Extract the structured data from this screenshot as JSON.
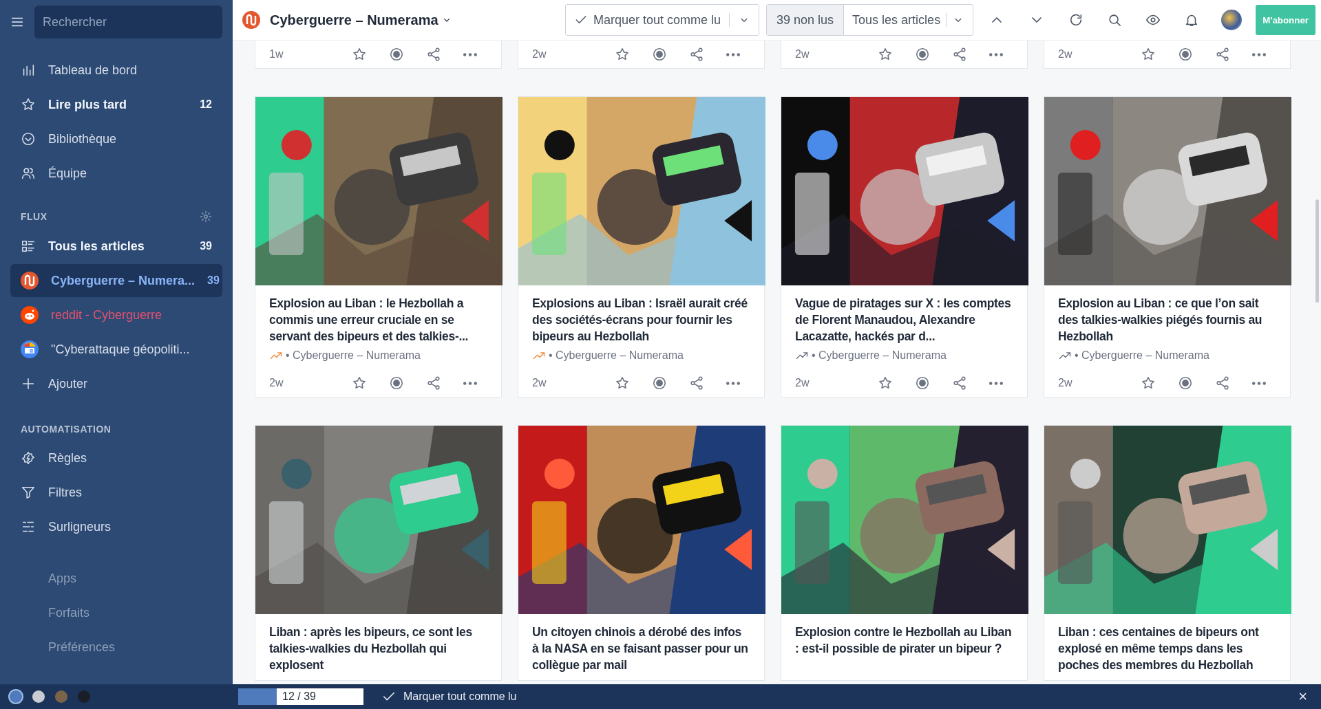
{
  "sidebar": {
    "search": {
      "placeholder": "Rechercher"
    },
    "nav": [
      {
        "label": "Tableau de bord",
        "unread": false
      },
      {
        "label": "Lire plus tard",
        "unread": true,
        "count": "12"
      },
      {
        "label": "Bibliothèque",
        "unread": false
      },
      {
        "label": "Équipe",
        "unread": false
      }
    ],
    "feeds_section": {
      "title": "FLUX",
      "items": [
        {
          "label": "Tous les articles",
          "unread": true,
          "count": "39",
          "selected": false,
          "error": false
        },
        {
          "label": "Cyberguerre – Numera...",
          "unread": true,
          "count": "39",
          "selected": true,
          "error": false
        },
        {
          "label": "reddit - Cyberguerre",
          "unread": false,
          "selected": false,
          "error": true
        },
        {
          "label": "\"Cyberattaque géopoliti...",
          "unread": false,
          "selected": false,
          "error": false
        },
        {
          "label": "Ajouter",
          "unread": false,
          "selected": false,
          "error": false
        }
      ]
    },
    "automation_section": {
      "title": "AUTOMATISATION",
      "items": [
        {
          "label": "Règles"
        },
        {
          "label": "Filtres"
        },
        {
          "label": "Surligneurs"
        }
      ]
    },
    "links": [
      "Apps",
      "Forfaits",
      "Préférences"
    ],
    "themes": [
      {
        "color": "#4f7bbd",
        "selected": true
      },
      {
        "color": "#c9cdd3",
        "selected": false
      },
      {
        "color": "#7b634a",
        "selected": false
      },
      {
        "color": "#1a1e27",
        "selected": false
      }
    ]
  },
  "toolbar": {
    "title": "Cyberguerre – Numerama",
    "mark_all": "Marquer tout comme lu",
    "unread_count": "39 non lus",
    "filter": "Tous les articles",
    "subscribe": "M'abonner"
  },
  "top_row": [
    {
      "age": "1w",
      "read": false
    },
    {
      "age": "2w",
      "read": false
    },
    {
      "age": "2w",
      "read": false
    },
    {
      "age": "2w",
      "read": false
    }
  ],
  "cards": [
    {
      "title": "Explosion au Liban : le Hezbollah a commis une erreur cruciale en se servant des bipeurs et des talkies-...",
      "trending": true,
      "source": "• Cyberguerre – Numerama",
      "age": "2w",
      "read": false
    },
    {
      "title": "Explosions au Liban : Israël aurait créé des sociétés-écrans pour fournir les bipeurs au Hezbollah",
      "trending": true,
      "source": "• Cyberguerre – Numerama",
      "age": "2w",
      "read": false
    },
    {
      "title": "Vague de piratages sur X : les comptes de Florent Manaudou, Alexandre Lacazatte, hackés par d...",
      "trending": false,
      "source": "• Cyberguerre – Numerama",
      "age": "2w",
      "read": false
    },
    {
      "title": "Explosion au Liban : ce que l’on sait des talkies-walkies piégés fournis au Hezbollah",
      "trending": false,
      "source": "• Cyberguerre – Numerama",
      "age": "2w",
      "read": false
    },
    {
      "title": "Liban : après les bipeurs, ce sont les talkies-walkies du Hezbollah qui explosent"
    },
    {
      "title": "Un citoyen chinois a dérobé des infos à la NASA en se faisant passer pour un collègue par mail"
    },
    {
      "title": "Explosion contre le Hezbollah au Liban : est-il possible de pirater un bipeur ?"
    },
    {
      "title": "Liban : ces centaines de bipeurs ont explosé en même temps dans les poches des membres du Hezbollah"
    }
  ],
  "status_bar": {
    "progress": "12 / 39",
    "level": 0.31,
    "mark_all": "Marquer tout comme lu",
    "close": "×"
  }
}
